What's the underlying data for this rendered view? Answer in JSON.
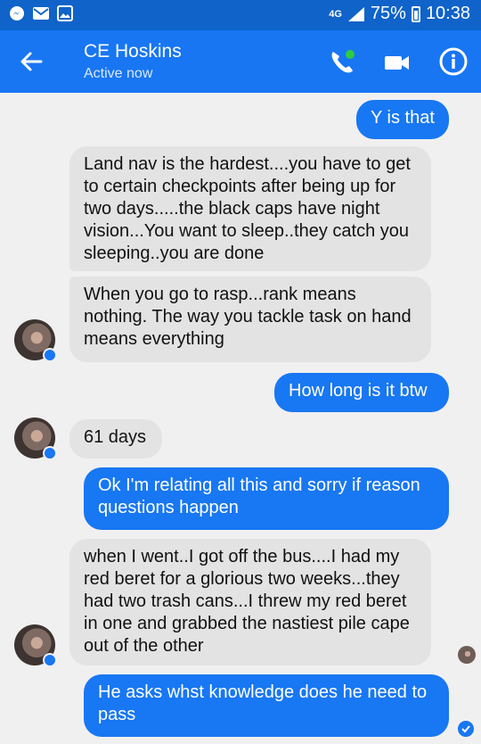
{
  "status_bar": {
    "network": "4G",
    "battery": "75%",
    "time": "10:38",
    "icons": [
      "messenger-icon",
      "email-icon",
      "image-icon",
      "signal-icon",
      "battery-icon"
    ]
  },
  "header": {
    "title": "CE Hoskins",
    "subtitle": "Active now",
    "icons": [
      "back-arrow-icon",
      "phone-icon",
      "video-camera-icon",
      "info-icon"
    ]
  },
  "colors": {
    "status_bar": "#0f63c9",
    "header": "#1876f2",
    "outgoing_bubble": "#1877f2",
    "incoming_bubble": "#e4e3e3",
    "background": "#f1f0f0"
  },
  "messages": [
    {
      "direction": "outgoing",
      "text": "Y is that"
    },
    {
      "direction": "incoming",
      "text": "Land nav is the hardest....you have to get to certain checkpoints after being up for two days.....the black caps have night vision...You want to sleep..they catch you sleeping..you are done"
    },
    {
      "direction": "incoming",
      "text": "When you go to rasp...rank means nothing. The way you tackle task on hand means everything"
    },
    {
      "direction": "outgoing",
      "text": "How long is it btw"
    },
    {
      "direction": "incoming",
      "text": "61 days"
    },
    {
      "direction": "outgoing",
      "text": "Ok I'm relating all this and sorry if reason questions happen"
    },
    {
      "direction": "incoming",
      "text": "when I went..I got off the bus....I had my red beret for a glorious two weeks...they had two trash cans...I threw my red beret in one and grabbed the nastiest pile cape out of the other"
    },
    {
      "direction": "outgoing",
      "text": "He asks whst knowledge does he need to pass"
    }
  ]
}
